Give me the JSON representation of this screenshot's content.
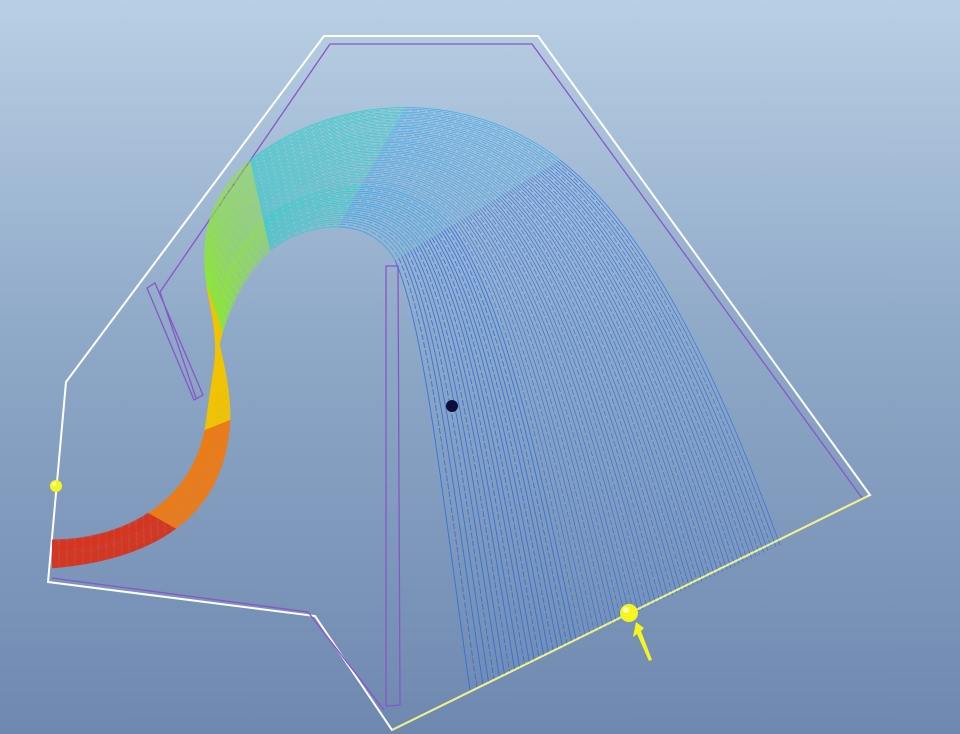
{
  "scene": {
    "background_top": "#b9cfe4",
    "background_bottom": "#6f88b0",
    "outer_boundary_color": "#ffffff",
    "inner_wall_color": "#8a55c8",
    "outlet_color": "#f2f26a",
    "marker_color": "#f5f520",
    "point_color": "#0b0f3a",
    "streamline_colors": [
      "#d8321a",
      "#f07a10",
      "#f2c400",
      "#e8f000",
      "#8ee63a",
      "#20d2c8",
      "#2aa8ee",
      "#1e6fe8"
    ],
    "streamline_count": 70,
    "icons": [
      "yellow-sphere-marker",
      "yellow-flow-arrow",
      "probe-point"
    ]
  }
}
